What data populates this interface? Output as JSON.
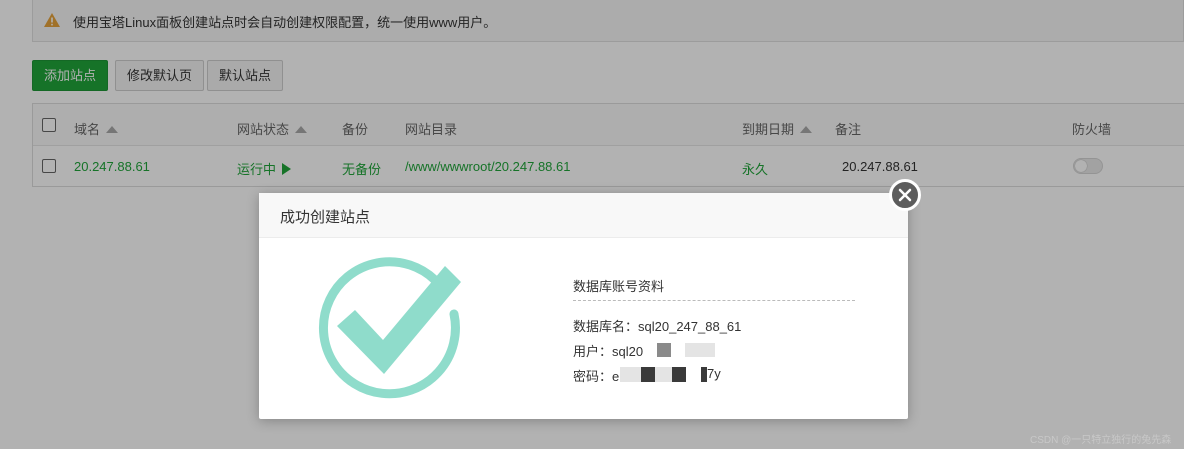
{
  "notice": {
    "icon": "warning-icon",
    "text": "使用宝塔Linux面板创建站点时会自动创建权限配置，统一使用www用户。"
  },
  "toolbar": {
    "add_site_label": "添加站点",
    "edit_default_page_label": "修改默认页",
    "default_site_label": "默认站点"
  },
  "table": {
    "headers": {
      "domain": "域名",
      "status": "网站状态",
      "backup": "备份",
      "directory": "网站目录",
      "expiry": "到期日期",
      "remark": "备注",
      "firewall": "防火墙"
    },
    "rows": [
      {
        "domain": "20.247.88.61",
        "status": "运行中",
        "backup": "无备份",
        "directory": "/www/wwwroot/20.247.88.61",
        "expiry": "永久",
        "remark": "20.247.88.61",
        "firewall_enabled": false
      }
    ]
  },
  "modal": {
    "title": "成功创建站点",
    "section_title": "数据库账号资料",
    "db_name_label": "数据库名：",
    "db_name_value": "sql20_247_88_61",
    "user_label": "用户：",
    "user_value_visible": "sql20",
    "password_label": "密码：",
    "password_value_visible_start": "e",
    "password_value_visible_end": "7y"
  },
  "colors": {
    "accent": "#20a53a",
    "success_check": "#8fdccb",
    "close_button": "#5d5d5d",
    "warning": "#e6a23c"
  },
  "watermark": "CSDN @一只特立独行的兔先森"
}
